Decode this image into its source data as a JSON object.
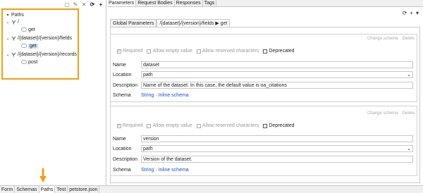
{
  "left_toolbar": {
    "icons": [
      "collapse-all-icon",
      "pencil-icon",
      "delete-icon",
      "refresh-icon",
      "add-icon"
    ]
  },
  "tree": {
    "root": "Paths",
    "paths": [
      {
        "label": "/",
        "ops": [
          "get"
        ]
      },
      {
        "label": "/{dataset}/{version}/fields",
        "ops": [
          "get"
        ]
      },
      {
        "label": "/{dataset}/{version}/records",
        "ops": [
          "post"
        ]
      }
    ]
  },
  "bottom_tabs": [
    "Form",
    "Schemas",
    "Paths",
    "Test",
    "petstore.json"
  ],
  "active_bottom_tab": "Paths",
  "top_tabs": [
    "Parameters",
    "Request Bodies",
    "Responses",
    "Tags"
  ],
  "right_toolbar": {
    "refresh": "⟳",
    "add": "+",
    "menu": "▾"
  },
  "crumbs": {
    "global": "Global Parameters",
    "path": "/{dataset}/{version}/fields ▶ get"
  },
  "block_actions": {
    "change_schema": "Change schema",
    "delete": "Delete"
  },
  "checkboxes": {
    "required": "Required",
    "allow_empty": "Allow empty value",
    "allow_reserved": "Allow reserved characters",
    "deprecated": "Deprecated"
  },
  "labels": {
    "name": "Name",
    "location": "Location",
    "description": "Description",
    "schema": "Schema"
  },
  "params": [
    {
      "name": "dataset",
      "location": "path",
      "description": "Name of the dataset. In this case, the default value is oa_citations",
      "schema": "String · Inline schema"
    },
    {
      "name": "version",
      "location": "path",
      "description": "Version of the dataset.",
      "schema": "String · Inline schema"
    }
  ],
  "colors": {
    "highlight": "#f0a010",
    "link": "#1a4fd6",
    "selection": "#cce4f7"
  }
}
